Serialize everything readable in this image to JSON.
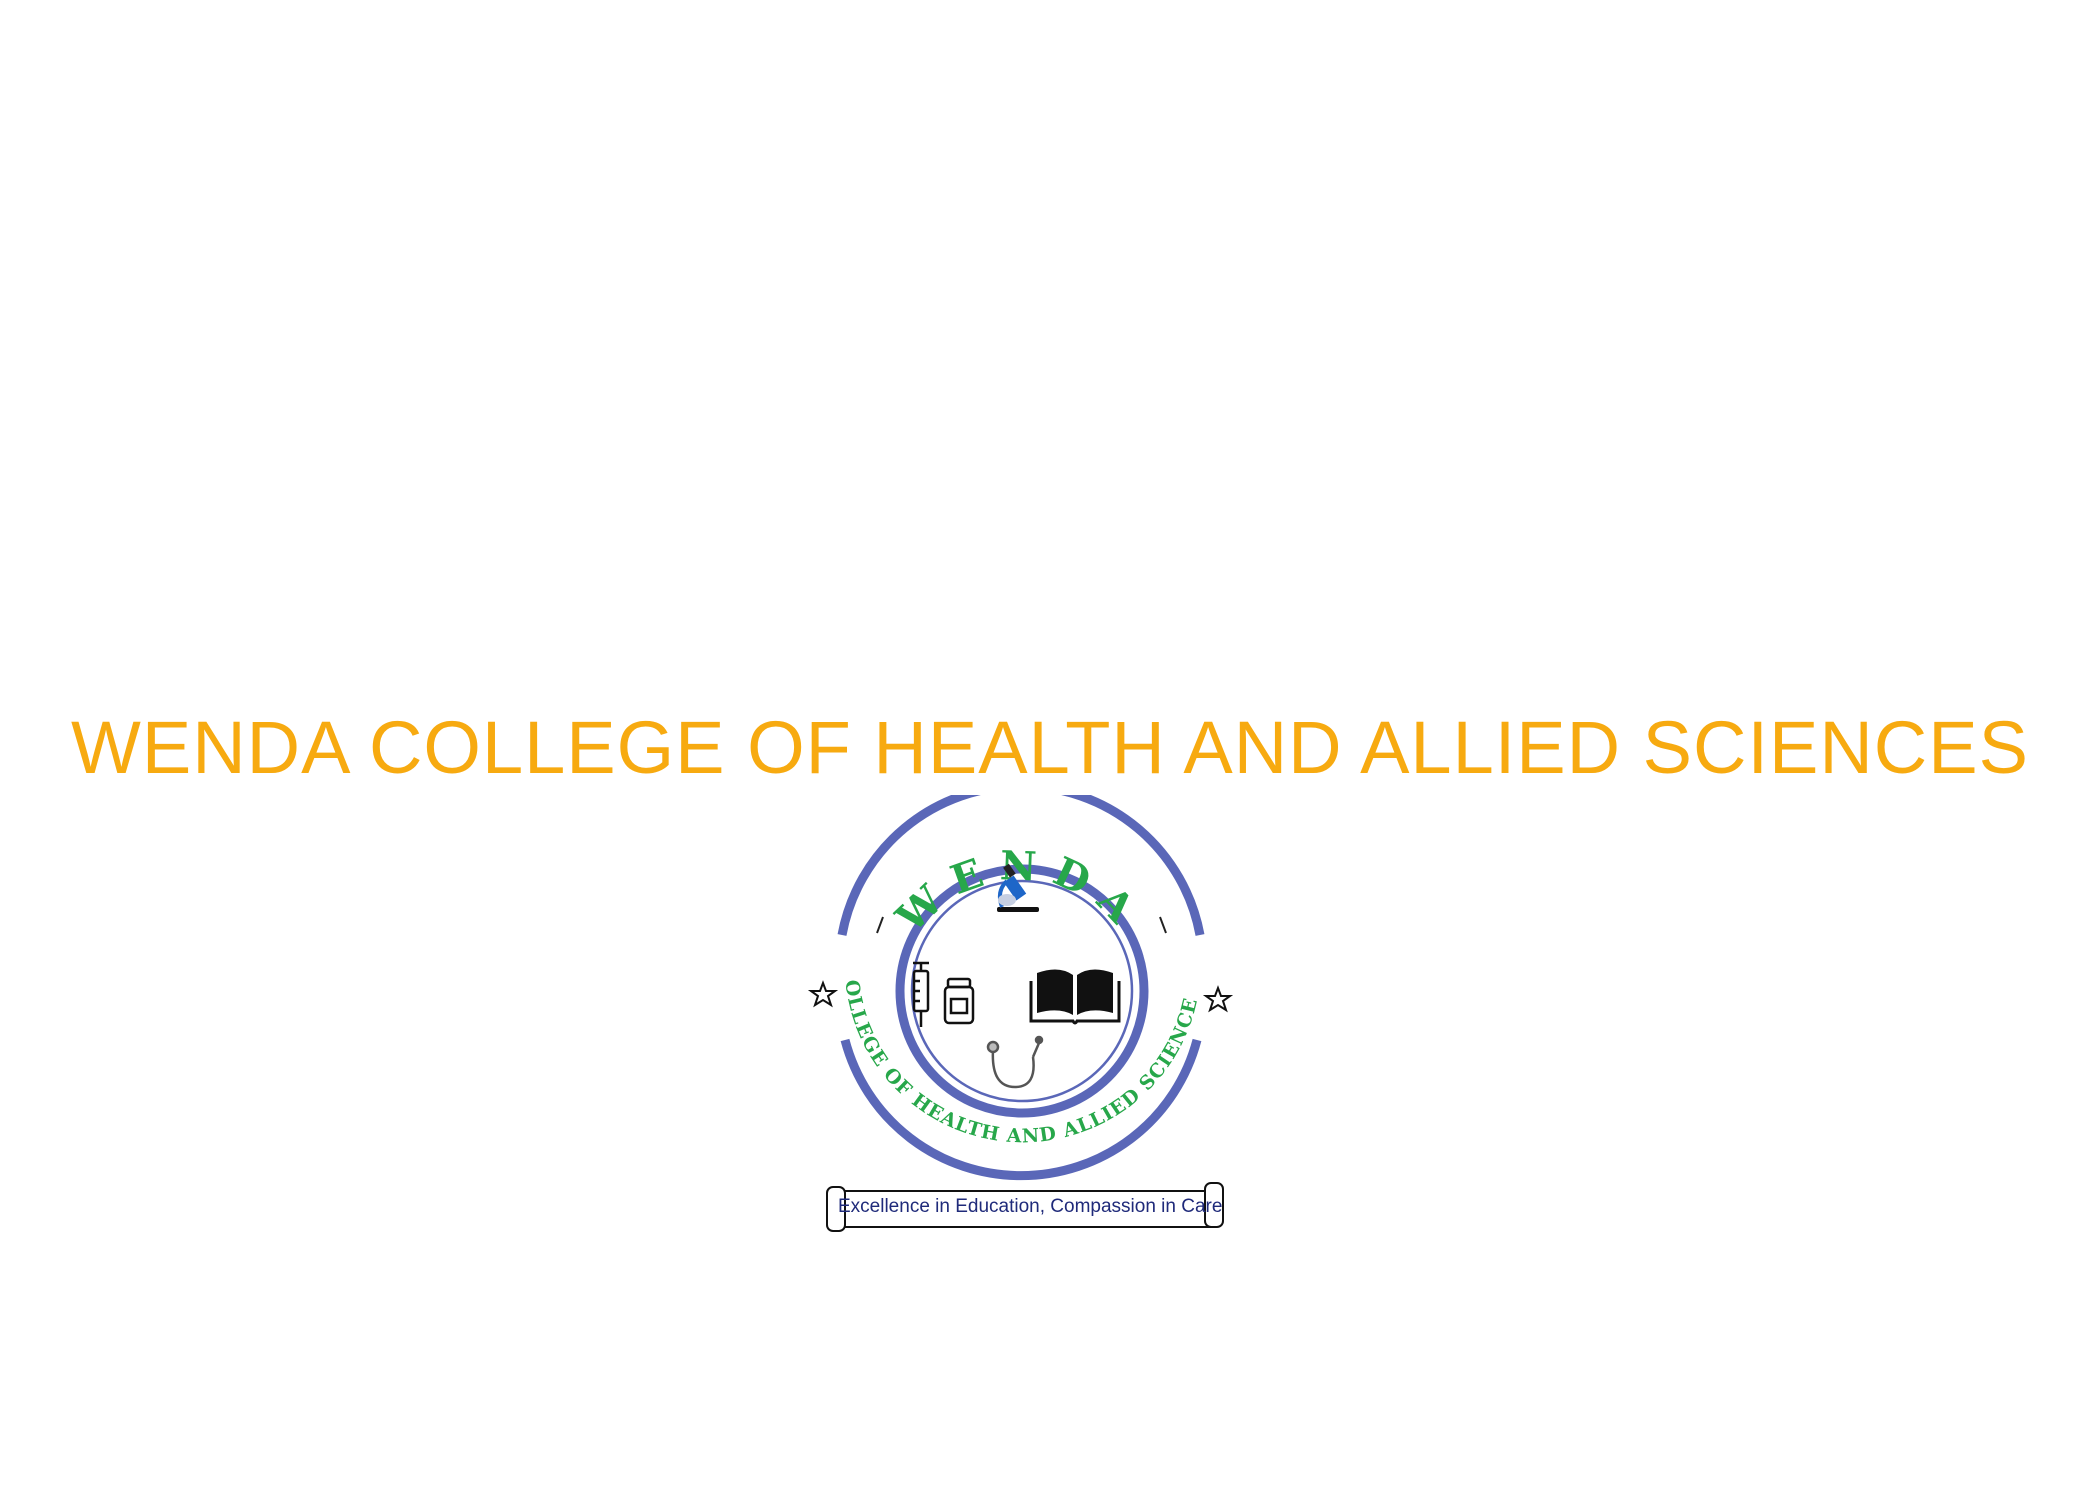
{
  "title": "WENDA COLLEGE OF HEALTH AND ALLIED SCIENCES",
  "logo": {
    "top_word": "WENDA",
    "arc_text": "COLLEGE OF HEALTH AND ALLIED SCIENCES",
    "motto": "Excellence in Education, Compassion in Care",
    "icons": [
      "microscope-icon",
      "syringe-icon",
      "medicine-bottle-icon",
      "book-icon",
      "stethoscope-icon",
      "star-icon"
    ]
  },
  "colors": {
    "title": "#F7AA10",
    "ring": "#5A67B8",
    "logo_text": "#27A74A",
    "motto_text": "#1F2A7A"
  }
}
